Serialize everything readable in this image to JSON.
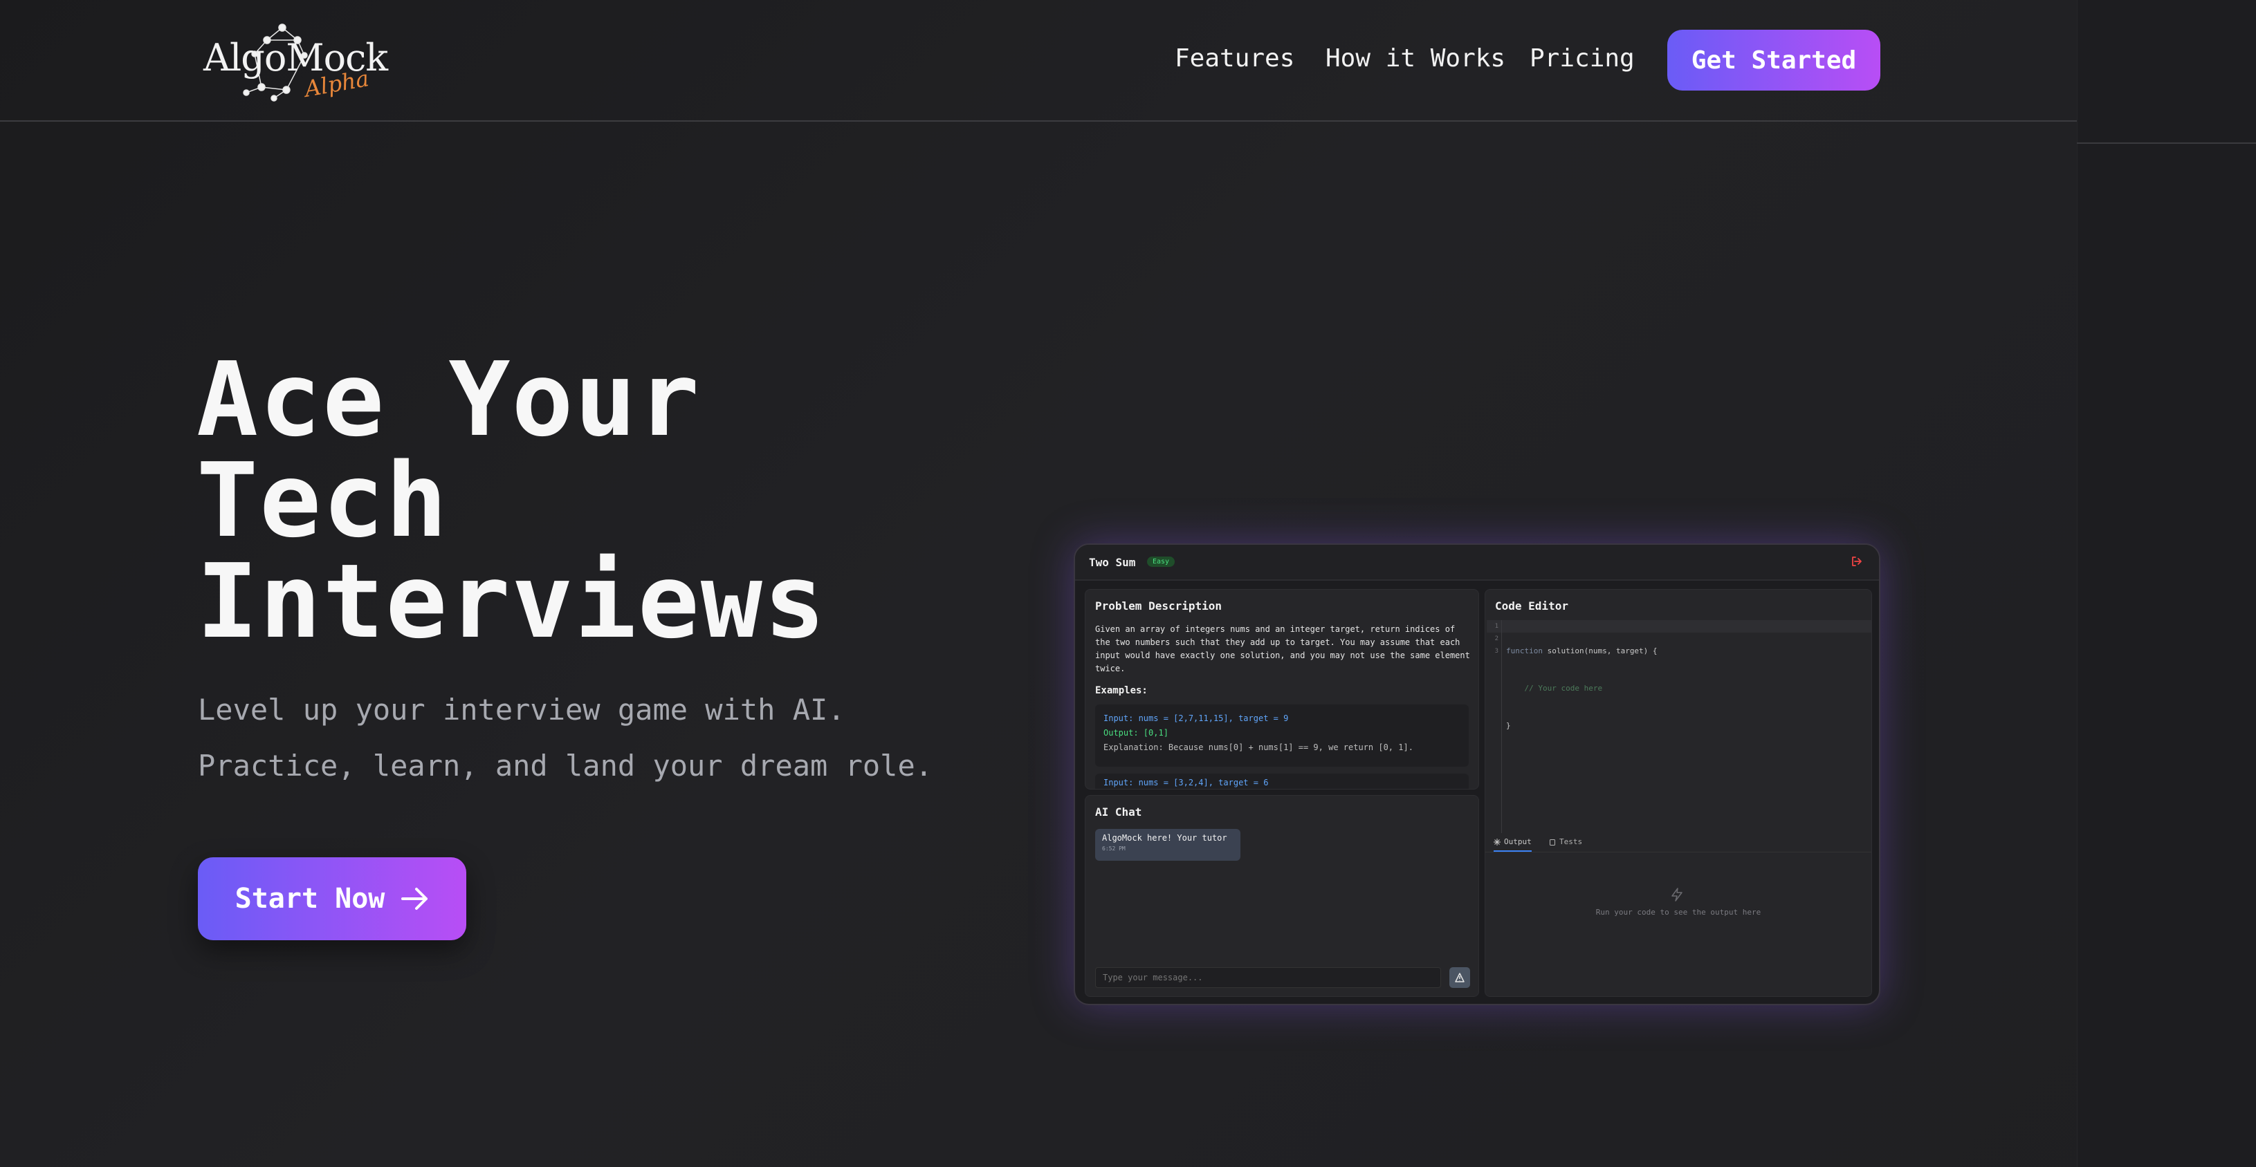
{
  "brand": {
    "name": "AlgoMock",
    "tag": "Alpha"
  },
  "nav": {
    "features": "Features",
    "how": "How it Works",
    "pricing": "Pricing",
    "cta": "Get Started"
  },
  "hero": {
    "title": [
      "Ace Your",
      "Tech",
      "Interviews"
    ],
    "subtitle_line1": "Level up your interview game with AI.",
    "subtitle_line2": "Practice, learn, and land your dream role.",
    "cta": "Start Now"
  },
  "preview": {
    "problem_title": "Two Sum",
    "difficulty": "Easy",
    "problem_desc_heading": "Problem Description",
    "problem_desc": "Given an array of integers nums and an integer target, return indices of the two numbers such that they add up to target. You may assume that each input would have exactly one solution, and you may not use the same element twice.",
    "examples_heading": "Examples:",
    "example1_input": "Input: nums = [2,7,11,15], target = 9",
    "example1_output": "Output: [0,1]",
    "example1_explanation": "Explanation: Because nums[0] + nums[1] == 9, we return [0, 1].",
    "example2_input": "Input: nums = [3,2,4], target = 6",
    "chat_heading": "AI Chat",
    "chat_message": "AlgoMock here! Your tutor",
    "chat_time": "6:52 PM",
    "chat_placeholder": "Type your message...",
    "code_heading": "Code Editor",
    "line_numbers": [
      "1",
      "2",
      "3"
    ],
    "code_line1_kw": "function",
    "code_line1_rest": " solution(nums, target) {",
    "code_line2": "    // Your code here",
    "code_line3": "}",
    "tab_output": "Output",
    "tab_tests": "Tests",
    "output_empty": "Run your code to see the output here"
  }
}
